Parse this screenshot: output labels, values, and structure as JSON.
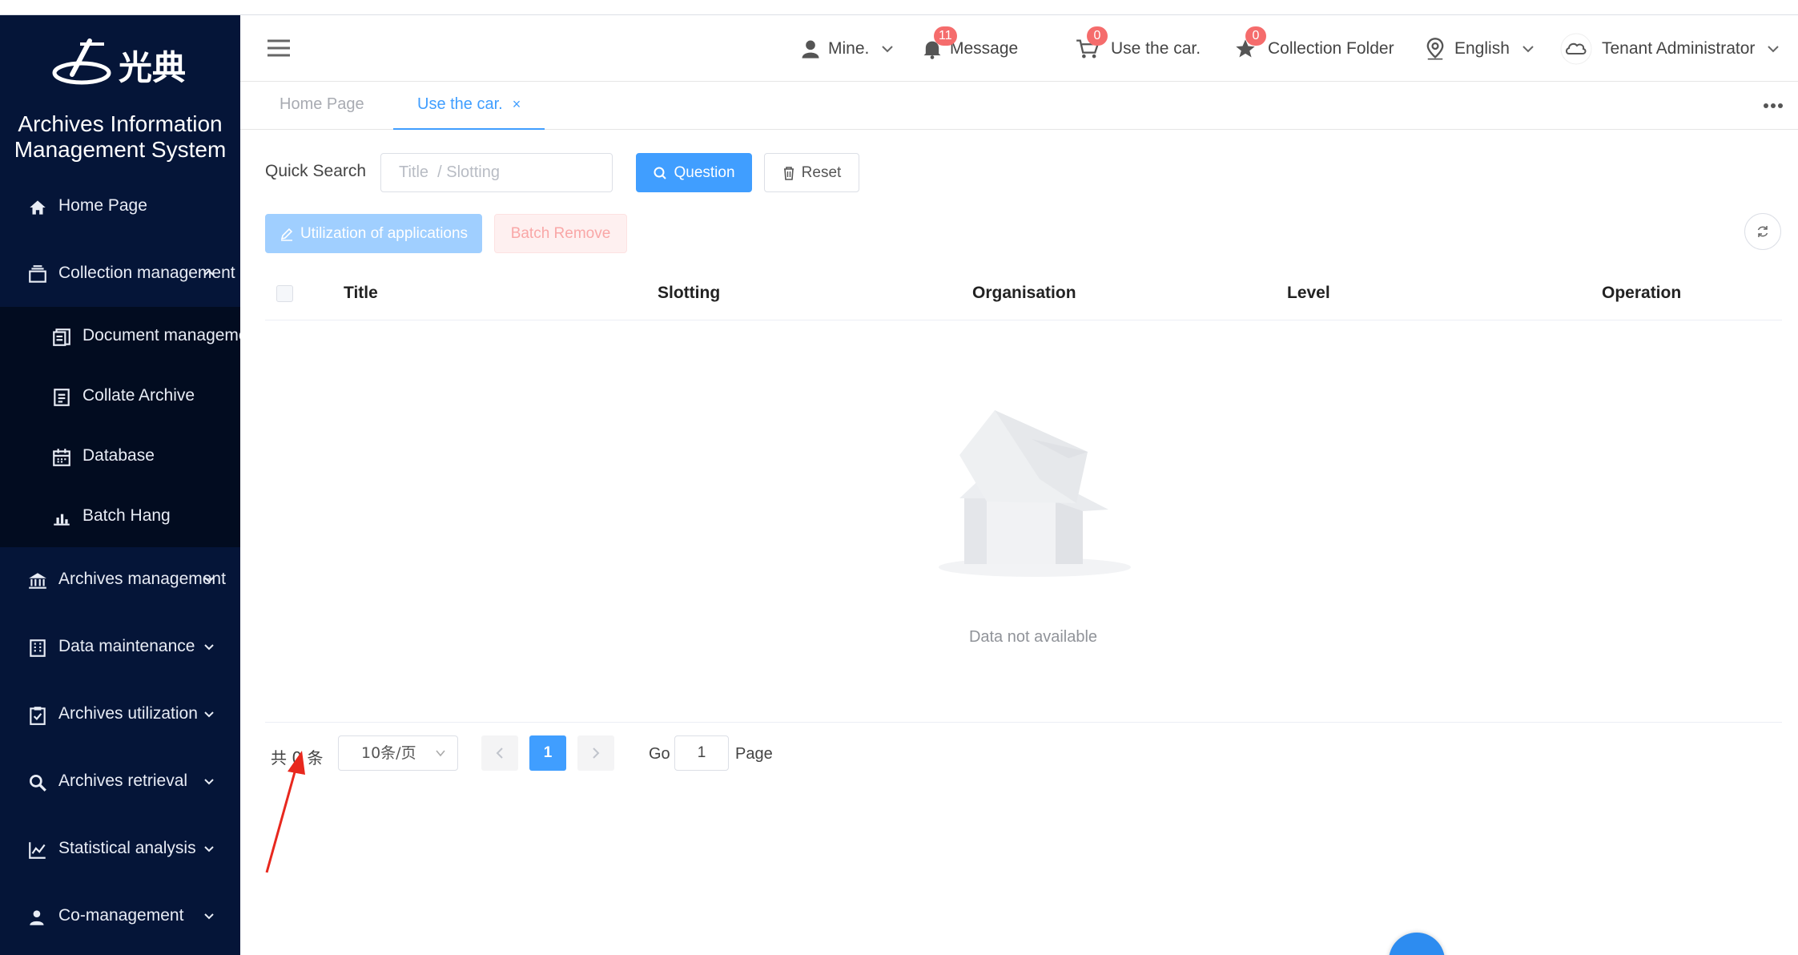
{
  "app": {
    "logo_text": "光典",
    "system_title_line1": "Archives Information",
    "system_title_line2": "Management System"
  },
  "sidebar": {
    "items": [
      {
        "label": "Home Page",
        "icon": "home-icon"
      },
      {
        "label": "Collection management",
        "icon": "collection-icon",
        "expanded": true
      },
      {
        "label": "Archives management",
        "icon": "bank-icon"
      },
      {
        "label": "Data maintenance",
        "icon": "building-icon"
      },
      {
        "label": "Archives utilization",
        "icon": "clipboard-check-icon"
      },
      {
        "label": "Archives retrieval",
        "icon": "search-icon"
      },
      {
        "label": "Statistical analysis",
        "icon": "line-chart-icon"
      },
      {
        "label": "Co-management",
        "icon": "user-group-icon"
      }
    ],
    "sub_items": [
      {
        "label": "Document management",
        "icon": "documents-icon"
      },
      {
        "label": "Collate Archive",
        "icon": "document-icon"
      },
      {
        "label": "Database",
        "icon": "calendar-icon"
      },
      {
        "label": "Batch Hang",
        "icon": "bar-chart-icon"
      }
    ]
  },
  "header": {
    "mine_label": "Mine.",
    "message_label": "Message",
    "message_badge": "11",
    "car_label": "Use the car.",
    "car_badge": "0",
    "collection_label": "Collection Folder",
    "collection_badge": "0",
    "language_label": "English",
    "user_label": "Tenant Administrator"
  },
  "tabs": [
    {
      "label": "Home Page",
      "active": false
    },
    {
      "label": "Use the car.",
      "active": true,
      "close": "×"
    }
  ],
  "search": {
    "label": "Quick Search",
    "placeholder": "Title  / Slotting",
    "query_button": "Question",
    "reset_button": "Reset"
  },
  "actions": {
    "apply_button": "Utilization of applications",
    "batch_remove_button": "Batch Remove"
  },
  "table": {
    "columns": [
      "Title",
      "Slotting",
      "Organisation",
      "Level",
      "Operation"
    ],
    "rows": [],
    "empty_text": "Data not available"
  },
  "pagination": {
    "total_text": "共 0 条",
    "page_size": "10条/页",
    "current_page": "1",
    "goto_label": "Go",
    "goto_value": "1",
    "page_label": "Page"
  },
  "colors": {
    "sidebar_bg": "#051538",
    "primary": "#409eff",
    "badge": "#f56c6c",
    "annotation_arrow": "#e8281e"
  }
}
